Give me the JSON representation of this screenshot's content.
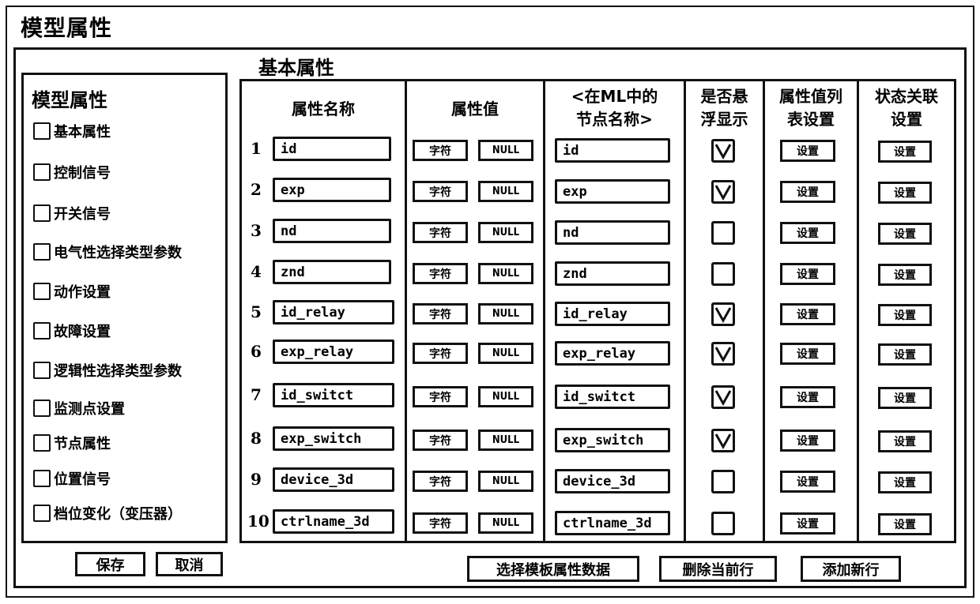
{
  "window": {
    "title": "模型属性"
  },
  "left_panel": {
    "title": "模型属性",
    "items": [
      {
        "label": "基本属性",
        "checked": false
      },
      {
        "label": "控制信号",
        "checked": false
      },
      {
        "label": "开关信号",
        "checked": false
      },
      {
        "label": "电气性选择类型参数",
        "checked": false
      },
      {
        "label": "动作设置",
        "checked": false
      },
      {
        "label": "故障设置",
        "checked": false
      },
      {
        "label": "逻辑性选择类型参数",
        "checked": false
      },
      {
        "label": "监测点设置",
        "checked": false
      },
      {
        "label": "节点属性",
        "checked": false
      },
      {
        "label": "位置信号",
        "checked": false
      },
      {
        "label": "档位变化（变压器）",
        "checked": false
      }
    ],
    "save_label": "保存",
    "cancel_label": "取消"
  },
  "main": {
    "section_title": "基本属性",
    "columns": {
      "name": "属性名称",
      "value": "属性值",
      "ml_node_line1": "<在ML中的",
      "ml_node_line2": "节点名称>",
      "float_line1": "是否悬",
      "float_line2": "浮显示",
      "list_line1": "属性值列",
      "list_line2": "表设置",
      "state_line1": "状态关联",
      "state_line2": "设置"
    },
    "type_button_label": "字符",
    "null_button_label": "NULL",
    "settings_button_label": "设置",
    "rows": [
      {
        "num": "1",
        "name": "id",
        "ml_node": "id",
        "float_display": true
      },
      {
        "num": "2",
        "name": "exp",
        "ml_node": "exp",
        "float_display": true
      },
      {
        "num": "3",
        "name": "nd",
        "ml_node": "nd",
        "float_display": false
      },
      {
        "num": "4",
        "name": "znd",
        "ml_node": "znd",
        "float_display": false
      },
      {
        "num": "5",
        "name": "id_relay",
        "ml_node": "id_relay",
        "float_display": true
      },
      {
        "num": "6",
        "name": "exp_relay",
        "ml_node": "exp_relay",
        "float_display": true
      },
      {
        "num": "7",
        "name": "id_switct",
        "ml_node": "id_switct",
        "float_display": true
      },
      {
        "num": "8",
        "name": "exp_switch",
        "ml_node": "exp_switch",
        "float_display": true
      },
      {
        "num": "9",
        "name": "device_3d",
        "ml_node": "device_3d",
        "float_display": false
      },
      {
        "num": "10",
        "name": "ctrlname_3d",
        "ml_node": "ctrlname_3d",
        "float_display": false
      }
    ],
    "footer": {
      "select_template_label": "选择模板属性数据",
      "delete_row_label": "删除当前行",
      "add_row_label": "添加新行"
    }
  }
}
